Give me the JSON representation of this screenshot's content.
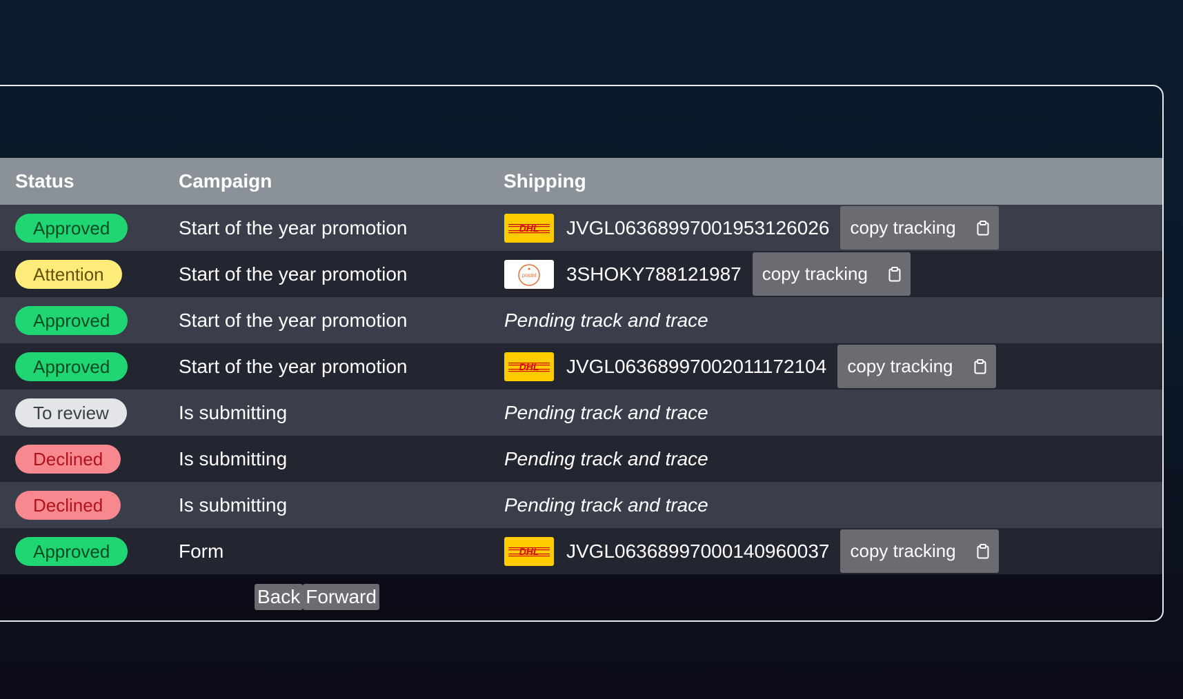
{
  "table": {
    "headers": {
      "status": "Status",
      "campaign": "Campaign",
      "shipping": "Shipping"
    },
    "rows": [
      {
        "status": "Approved",
        "status_kind": "approved",
        "campaign": "Start of the year promotion",
        "carrier": "dhl",
        "tracking": "JVGL06368997001953126026",
        "copy_label": "copy tracking",
        "pending": ""
      },
      {
        "status": "Attention",
        "status_kind": "attention",
        "campaign": "Start of the year promotion",
        "carrier": "postnl",
        "tracking": "3SHOKY788121987",
        "copy_label": "copy tracking",
        "pending": ""
      },
      {
        "status": "Approved",
        "status_kind": "approved",
        "campaign": "Start of the year promotion",
        "carrier": "",
        "tracking": "",
        "copy_label": "",
        "pending": "Pending track and trace"
      },
      {
        "status": "Approved",
        "status_kind": "approved",
        "campaign": "Start of the year promotion",
        "carrier": "dhl",
        "tracking": "JVGL06368997002011172104",
        "copy_label": "copy tracking",
        "pending": ""
      },
      {
        "status": "To review",
        "status_kind": "review",
        "campaign": "Is submitting",
        "carrier": "",
        "tracking": "",
        "copy_label": "",
        "pending": "Pending track and trace"
      },
      {
        "status": "Declined",
        "status_kind": "declined",
        "campaign": "Is submitting",
        "carrier": "",
        "tracking": "",
        "copy_label": "",
        "pending": "Pending track and trace"
      },
      {
        "status": "Declined",
        "status_kind": "declined",
        "campaign": "Is submitting",
        "carrier": "",
        "tracking": "",
        "copy_label": "",
        "pending": "Pending track and trace"
      },
      {
        "status": "Approved",
        "status_kind": "approved",
        "campaign": "Form",
        "carrier": "dhl",
        "tracking": "JVGL06368997000140960037",
        "copy_label": "copy tracking",
        "pending": ""
      }
    ]
  },
  "carriers": {
    "dhl": {
      "logo_text": "DHL",
      "icon": "dhl-logo"
    },
    "postnl": {
      "logo_text": "postnl",
      "icon": "postnl-logo"
    }
  },
  "pagination": {
    "back_label": "Back",
    "forward_label": "Forward"
  },
  "colors": {
    "approved": "#1fd673",
    "attention": "#fdeb7a",
    "review": "#e3e5e8",
    "declined": "#f7888f",
    "header_bg": "#8a9199",
    "dhl_yellow": "#ffcc00",
    "dhl_red": "#d40511"
  },
  "icons": {
    "copy": "clipboard-icon"
  }
}
